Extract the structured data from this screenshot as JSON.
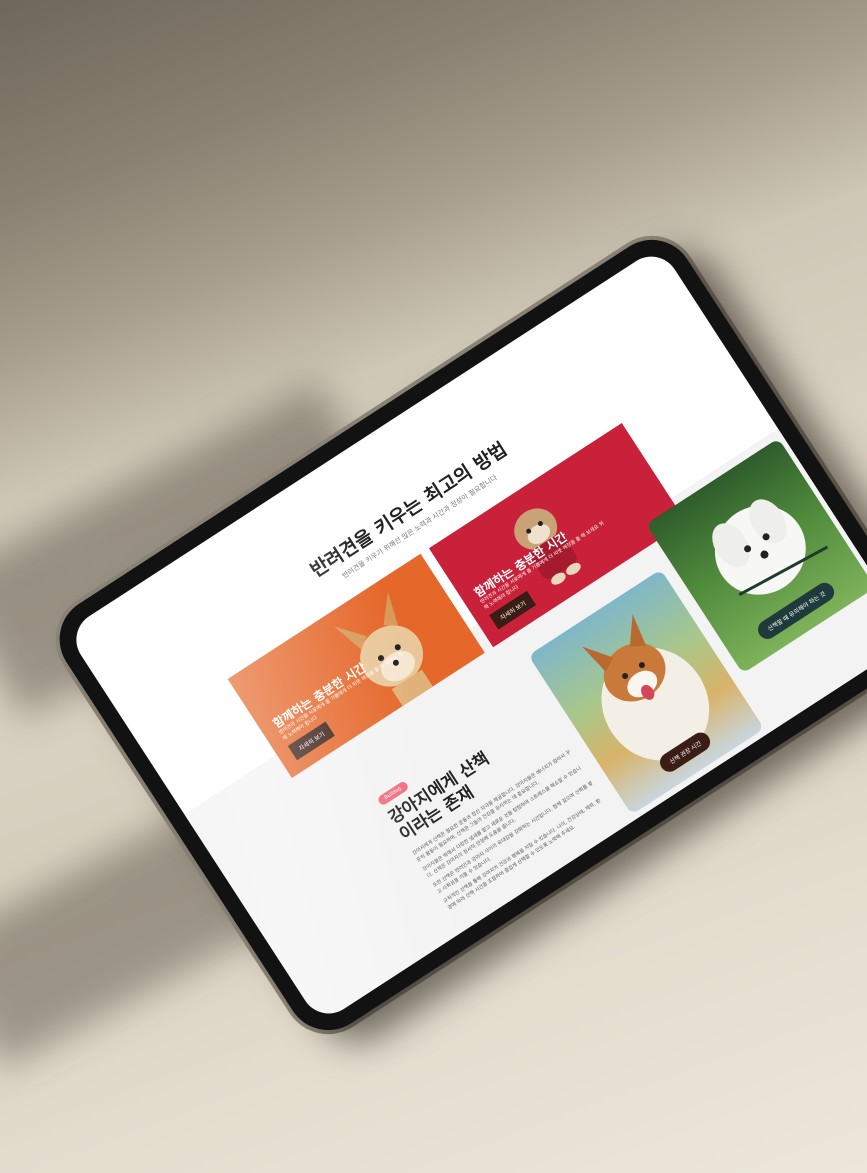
{
  "page": {
    "heading": "반려견을 키우는 최고의 방법",
    "subheading": "반려견을 키우기 위해선 많은 노력과 시간과 정성이 필요합니다"
  },
  "cards": [
    {
      "title": "함께하는 충분한 시간",
      "description": "반려견과 시간을 서로에게 줄 기쁨에게 더 따뜻 애정을 줄 해 보세요 위해 노력해야 합니다",
      "button_label": "자세히 보기",
      "color": "#e5672a",
      "image": "corgi-puppy"
    },
    {
      "title": "함께하는 충분한 시간",
      "description": "반려견과 시간을 서로에게 줄 기쁨에게 더 따뜻 애정을 줄 해 보세요 위해 노력해야 합니다",
      "button_label": "자세히 보기",
      "color": "#c92139",
      "image": "shih-tzu"
    }
  ],
  "info": {
    "badge": "Bulldog",
    "title_lines": [
      "강아지에게 산책",
      "이라는 존재"
    ],
    "paragraphs": [
      "강아지에게 산책은 필요한 운동과 정신 자극을 제공합니다. 강아지들은 에너지가 많아서 꾸준히 활동이 필요하며, 산책은 그들의 건강을 유지하는 데 중요합니다.",
      "강아지들은 밖에서 다양한 냄새를 맡고 새로운 것을 탐험하며 스트레스를 해소할 수 있습니다. 산책은 강아지의 정서적 안정에 도움을 줍니다.",
      "또한 산책은 반려인과 강아지 사이의 유대감을 강화하는 시간입니다. 함께 걸으며 신뢰를 쌓고 사회성을 키울 수 있습니다.",
      "규칙적인 산책을 통해 강아지의 건강과 행복을 지킬 수 있습니다. 나이, 건강상태, 체력, 환경에 따라 산책 시간을 조절하여 즐겁게 산책할 수 있도록 노력해 주세요."
    ]
  },
  "photos": [
    {
      "button_label": "산책 권장 시간",
      "image": "corgi-outdoor"
    },
    {
      "button_label": "산책할 때 유의해야 하는 것",
      "image": "maltese-grass"
    }
  ]
}
